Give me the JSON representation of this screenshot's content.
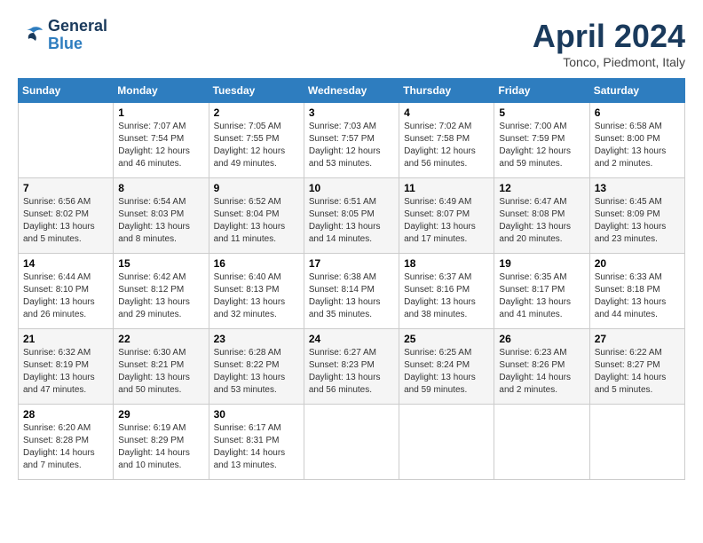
{
  "header": {
    "logo_line1": "General",
    "logo_line2": "Blue",
    "month_title": "April 2024",
    "location": "Tonco, Piedmont, Italy"
  },
  "days_of_week": [
    "Sunday",
    "Monday",
    "Tuesday",
    "Wednesday",
    "Thursday",
    "Friday",
    "Saturday"
  ],
  "weeks": [
    [
      {
        "day": "",
        "info": ""
      },
      {
        "day": "1",
        "info": "Sunrise: 7:07 AM\nSunset: 7:54 PM\nDaylight: 12 hours\nand 46 minutes."
      },
      {
        "day": "2",
        "info": "Sunrise: 7:05 AM\nSunset: 7:55 PM\nDaylight: 12 hours\nand 49 minutes."
      },
      {
        "day": "3",
        "info": "Sunrise: 7:03 AM\nSunset: 7:57 PM\nDaylight: 12 hours\nand 53 minutes."
      },
      {
        "day": "4",
        "info": "Sunrise: 7:02 AM\nSunset: 7:58 PM\nDaylight: 12 hours\nand 56 minutes."
      },
      {
        "day": "5",
        "info": "Sunrise: 7:00 AM\nSunset: 7:59 PM\nDaylight: 12 hours\nand 59 minutes."
      },
      {
        "day": "6",
        "info": "Sunrise: 6:58 AM\nSunset: 8:00 PM\nDaylight: 13 hours\nand 2 minutes."
      }
    ],
    [
      {
        "day": "7",
        "info": "Sunrise: 6:56 AM\nSunset: 8:02 PM\nDaylight: 13 hours\nand 5 minutes."
      },
      {
        "day": "8",
        "info": "Sunrise: 6:54 AM\nSunset: 8:03 PM\nDaylight: 13 hours\nand 8 minutes."
      },
      {
        "day": "9",
        "info": "Sunrise: 6:52 AM\nSunset: 8:04 PM\nDaylight: 13 hours\nand 11 minutes."
      },
      {
        "day": "10",
        "info": "Sunrise: 6:51 AM\nSunset: 8:05 PM\nDaylight: 13 hours\nand 14 minutes."
      },
      {
        "day": "11",
        "info": "Sunrise: 6:49 AM\nSunset: 8:07 PM\nDaylight: 13 hours\nand 17 minutes."
      },
      {
        "day": "12",
        "info": "Sunrise: 6:47 AM\nSunset: 8:08 PM\nDaylight: 13 hours\nand 20 minutes."
      },
      {
        "day": "13",
        "info": "Sunrise: 6:45 AM\nSunset: 8:09 PM\nDaylight: 13 hours\nand 23 minutes."
      }
    ],
    [
      {
        "day": "14",
        "info": "Sunrise: 6:44 AM\nSunset: 8:10 PM\nDaylight: 13 hours\nand 26 minutes."
      },
      {
        "day": "15",
        "info": "Sunrise: 6:42 AM\nSunset: 8:12 PM\nDaylight: 13 hours\nand 29 minutes."
      },
      {
        "day": "16",
        "info": "Sunrise: 6:40 AM\nSunset: 8:13 PM\nDaylight: 13 hours\nand 32 minutes."
      },
      {
        "day": "17",
        "info": "Sunrise: 6:38 AM\nSunset: 8:14 PM\nDaylight: 13 hours\nand 35 minutes."
      },
      {
        "day": "18",
        "info": "Sunrise: 6:37 AM\nSunset: 8:16 PM\nDaylight: 13 hours\nand 38 minutes."
      },
      {
        "day": "19",
        "info": "Sunrise: 6:35 AM\nSunset: 8:17 PM\nDaylight: 13 hours\nand 41 minutes."
      },
      {
        "day": "20",
        "info": "Sunrise: 6:33 AM\nSunset: 8:18 PM\nDaylight: 13 hours\nand 44 minutes."
      }
    ],
    [
      {
        "day": "21",
        "info": "Sunrise: 6:32 AM\nSunset: 8:19 PM\nDaylight: 13 hours\nand 47 minutes."
      },
      {
        "day": "22",
        "info": "Sunrise: 6:30 AM\nSunset: 8:21 PM\nDaylight: 13 hours\nand 50 minutes."
      },
      {
        "day": "23",
        "info": "Sunrise: 6:28 AM\nSunset: 8:22 PM\nDaylight: 13 hours\nand 53 minutes."
      },
      {
        "day": "24",
        "info": "Sunrise: 6:27 AM\nSunset: 8:23 PM\nDaylight: 13 hours\nand 56 minutes."
      },
      {
        "day": "25",
        "info": "Sunrise: 6:25 AM\nSunset: 8:24 PM\nDaylight: 13 hours\nand 59 minutes."
      },
      {
        "day": "26",
        "info": "Sunrise: 6:23 AM\nSunset: 8:26 PM\nDaylight: 14 hours\nand 2 minutes."
      },
      {
        "day": "27",
        "info": "Sunrise: 6:22 AM\nSunset: 8:27 PM\nDaylight: 14 hours\nand 5 minutes."
      }
    ],
    [
      {
        "day": "28",
        "info": "Sunrise: 6:20 AM\nSunset: 8:28 PM\nDaylight: 14 hours\nand 7 minutes."
      },
      {
        "day": "29",
        "info": "Sunrise: 6:19 AM\nSunset: 8:29 PM\nDaylight: 14 hours\nand 10 minutes."
      },
      {
        "day": "30",
        "info": "Sunrise: 6:17 AM\nSunset: 8:31 PM\nDaylight: 14 hours\nand 13 minutes."
      },
      {
        "day": "",
        "info": ""
      },
      {
        "day": "",
        "info": ""
      },
      {
        "day": "",
        "info": ""
      },
      {
        "day": "",
        "info": ""
      }
    ]
  ]
}
